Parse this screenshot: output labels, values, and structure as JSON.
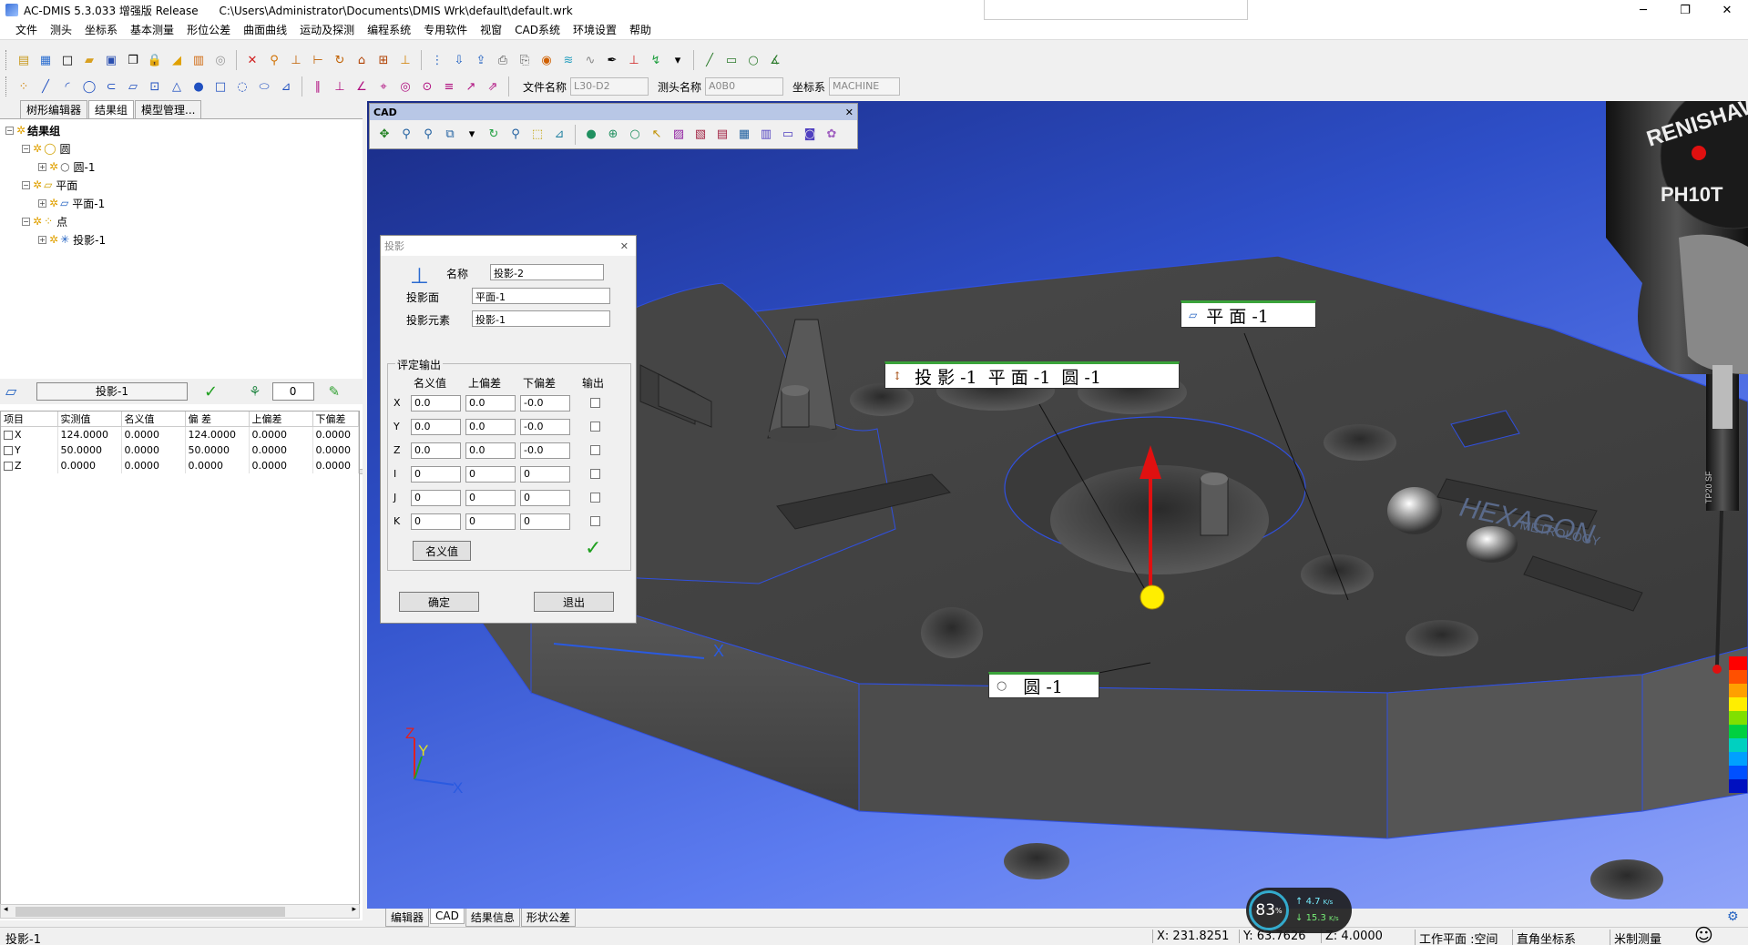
{
  "window": {
    "title": "AC-DMIS 5.3.033 增强版 Release      C:\\Users\\Administrator\\Documents\\DMIS Wrk\\default\\default.wrk"
  },
  "menu": [
    "文件",
    "测头",
    "坐标系",
    "基本测量",
    "形位公差",
    "曲面曲线",
    "运动及探测",
    "编程系统",
    "专用软件",
    "视窗",
    "CAD系统",
    "环境设置",
    "帮助"
  ],
  "toolbar2": {
    "file_label": "文件名称",
    "file_value": "L30-D2",
    "probe_label": "测头名称",
    "probe_value": "A0B0",
    "coord_label": "坐标系",
    "coord_value": "MACHINE"
  },
  "left_tabs": [
    "树形编辑器",
    "结果组",
    "模型管理..."
  ],
  "tree": {
    "root": "结果组",
    "groups": [
      {
        "label": "圆",
        "child": "圆-1"
      },
      {
        "label": "平面",
        "child": "平面-1"
      },
      {
        "label": "点",
        "child": "投影-1"
      }
    ]
  },
  "measure_bar": {
    "name": "投影-1",
    "count": "0"
  },
  "measure_table": {
    "headers": [
      "项目",
      "实测值",
      "名义值",
      "偏 差",
      "上偏差",
      "下偏差"
    ],
    "rows": [
      [
        "X",
        "124.0000",
        "0.0000",
        "124.0000",
        "0.0000",
        "0.0000"
      ],
      [
        "Y",
        "50.0000",
        "0.0000",
        "50.0000",
        "0.0000",
        "0.0000"
      ],
      [
        "Z",
        "0.0000",
        "0.0000",
        "0.0000",
        "0.0000",
        "0.0000"
      ]
    ]
  },
  "cad_toolbar": {
    "title": "CAD"
  },
  "dialog": {
    "title": "投影",
    "name_label": "名称",
    "name_value": "投影-2",
    "plane_label": "投影面",
    "plane_value": "平面-1",
    "element_label": "投影元素",
    "element_value": "投影-1",
    "group_title": "评定输出",
    "col_headers": [
      "名义值",
      "上偏差",
      "下偏差",
      "输出"
    ],
    "rows": [
      {
        "axis": "X",
        "nominal": "0.0",
        "upper": "0.0",
        "lower": "-0.0"
      },
      {
        "axis": "Y",
        "nominal": "0.0",
        "upper": "0.0",
        "lower": "-0.0"
      },
      {
        "axis": "Z",
        "nominal": "0.0",
        "upper": "0.0",
        "lower": "-0.0"
      },
      {
        "axis": "I",
        "nominal": "0",
        "upper": "0",
        "lower": "0"
      },
      {
        "axis": "J",
        "nominal": "0",
        "upper": "0",
        "lower": "0"
      },
      {
        "axis": "K",
        "nominal": "0",
        "upper": "0",
        "lower": "0"
      }
    ],
    "nominal_button": "名义值",
    "ok_button": "确定",
    "exit_button": "退出"
  },
  "viewport_labels": {
    "plane": "平 面 -1",
    "projection": "投 影 -1  平 面 -1  圆 -1",
    "circle": "圆 -1",
    "brand_top": "RENISHAW",
    "brand_head": "PH10T",
    "hexagon": "HEXAGON",
    "metrology": "METROLOGY",
    "probe_tip": "TP20 SF",
    "axis_z": "Z",
    "axis_y": "Y",
    "axis_x": "X",
    "cursor_x": "X"
  },
  "bottom_tabs": [
    "编辑器",
    "CAD",
    "结果信息",
    "形状公差"
  ],
  "status": {
    "left": "投影-1",
    "x": "X: 231.8251",
    "y": "Y: 63.7626",
    "z": "Z: 4.0000",
    "workplane": "工作平面 :空间",
    "coords": "直角坐标系",
    "units": "米制测量"
  },
  "perf": {
    "percent": "83",
    "up": "4.7",
    "up_unit": "K/s",
    "down": "15.3",
    "down_unit": "K/s"
  },
  "colors": {
    "viewport_top": "#1a2c86",
    "label_border": "#3aa33a",
    "arrow": "#e01010",
    "point": "#ffee00"
  }
}
